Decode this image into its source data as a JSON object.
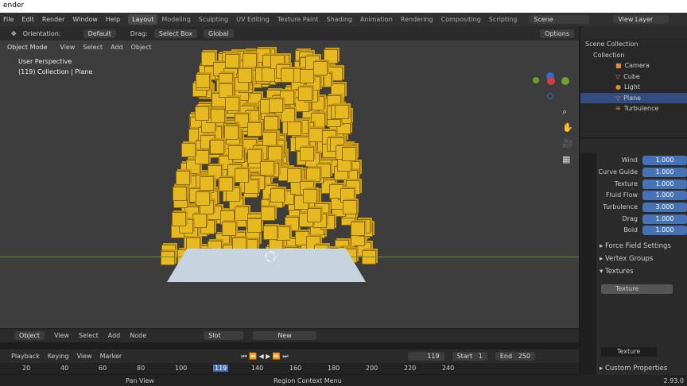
{
  "window_title": "ender",
  "menu": [
    "File",
    "Edit",
    "Render",
    "Window",
    "Help"
  ],
  "workspaces": [
    "Layout",
    "Modeling",
    "Sculpting",
    "UV Editing",
    "Texture Paint",
    "Shading",
    "Animation",
    "Rendering",
    "Compositing",
    "Scripting"
  ],
  "scene": "Scene",
  "view_layer": "View Layer",
  "tool_header": {
    "orientation_label": "Orientation:",
    "orientation": "Default",
    "drag_label": "Drag:",
    "drag": "Select Box",
    "transform": "Global",
    "options": "Options"
  },
  "viewport": {
    "mode": "Object Mode",
    "menu": [
      "View",
      "Select",
      "Add",
      "Object"
    ],
    "info1": "User Perspective",
    "info2": "(119) Collection | Plane"
  },
  "outliner": {
    "items": [
      {
        "label": "Scene Collection"
      },
      {
        "label": "Collection"
      },
      {
        "label": "Camera"
      },
      {
        "label": "Cube"
      },
      {
        "label": "Light"
      },
      {
        "label": "Plane"
      },
      {
        "label": "Turbulence"
      }
    ]
  },
  "properties": {
    "weights": [
      {
        "label": "Wind",
        "value": "1.000"
      },
      {
        "label": "Curve Guide",
        "value": "1.000"
      },
      {
        "label": "Texture",
        "value": "1.000"
      },
      {
        "label": "Fluid Flow",
        "value": "1.000"
      },
      {
        "label": "Turbulence",
        "value": "3.000"
      },
      {
        "label": "Drag",
        "value": "1.000"
      },
      {
        "label": "Boid",
        "value": "1.000"
      }
    ],
    "sections": [
      "Force Field Settings",
      "Vertex Groups",
      "Textures",
      "Custom Properties"
    ],
    "texture_slot": "Texture",
    "texture_name": "Texture"
  },
  "node_header": {
    "editor": "Object",
    "menu": [
      "View",
      "Select",
      "Add",
      "Node"
    ],
    "slot": "Slot",
    "new": "New"
  },
  "timeline": {
    "menu": [
      "Playback",
      "Keying",
      "View",
      "Marker"
    ],
    "current": "119",
    "start_label": "Start",
    "start": "1",
    "end_label": "End",
    "end": "250",
    "ticks": [
      "20",
      "40",
      "60",
      "80",
      "100",
      "119",
      "140",
      "160",
      "180",
      "200",
      "220",
      "240"
    ]
  },
  "status": {
    "pan": "Pan View",
    "context": "Region Context Menu",
    "version": "2.93.0"
  }
}
